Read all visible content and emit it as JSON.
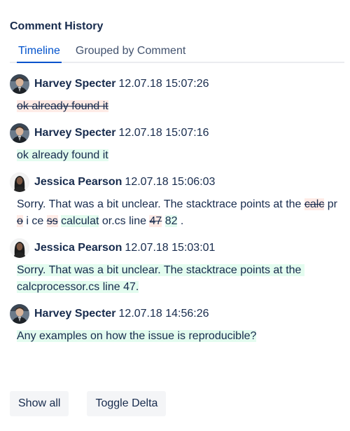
{
  "panel": {
    "title": "Comment History"
  },
  "tabs": [
    {
      "label": "Timeline",
      "active": true
    },
    {
      "label": "Grouped by Comment",
      "active": false
    }
  ],
  "entries": [
    {
      "author": "Harvey Specter",
      "timestamp": "12.07.18 15:07:26",
      "avatar": "man",
      "segments": [
        {
          "type": "del",
          "text": "ok already found it"
        }
      ]
    },
    {
      "author": "Harvey Specter",
      "timestamp": "12.07.18 15:07:16",
      "avatar": "man",
      "segments": [
        {
          "type": "add",
          "text": "ok already found it"
        }
      ]
    },
    {
      "author": "Jessica Pearson",
      "timestamp": "12.07.18 15:06:03",
      "avatar": "woman",
      "segments": [
        {
          "type": "neu",
          "text": "Sorry. That was a bit unclear. The stacktrace points at the "
        },
        {
          "type": "del",
          "text": "calc"
        },
        {
          "type": "neu",
          "text": " pr "
        },
        {
          "type": "del",
          "text": "o"
        },
        {
          "type": "neu",
          "text": " i ce "
        },
        {
          "type": "del",
          "text": "ss"
        },
        {
          "type": "neu",
          "text": " "
        },
        {
          "type": "add",
          "text": "calculat"
        },
        {
          "type": "neu",
          "text": " or.cs line "
        },
        {
          "type": "del",
          "text": "47"
        },
        {
          "type": "neu",
          "text": " "
        },
        {
          "type": "add",
          "text": "82"
        },
        {
          "type": "neu",
          "text": " ."
        }
      ]
    },
    {
      "author": "Jessica Pearson",
      "timestamp": "12.07.18 15:03:01",
      "avatar": "woman",
      "segments": [
        {
          "type": "add",
          "text": "Sorry. That was a bit unclear. The stacktrace points at the calcprocessor.cs line 47."
        }
      ]
    },
    {
      "author": "Harvey Specter",
      "timestamp": "12.07.18 14:56:26",
      "avatar": "man",
      "segments": [
        {
          "type": "add",
          "text": "Any examples on how the issue is reproducible?"
        }
      ]
    }
  ],
  "buttons": {
    "show_all": "Show all",
    "toggle_delta": "Toggle Delta"
  },
  "colors": {
    "added_bg": "#e3fcef",
    "removed_bg": "#ffebe6",
    "accent": "#0052cc",
    "text": "#172b4d"
  }
}
